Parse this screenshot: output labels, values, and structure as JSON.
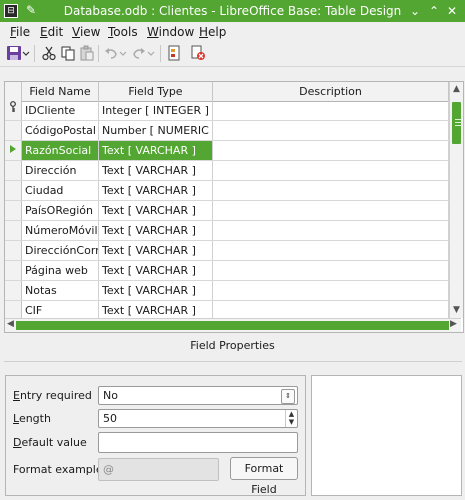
{
  "window": {
    "title": "Database.odb : Clientes - LibreOffice Base: Table Design",
    "app_icon_glyph": "⊟",
    "pin_glyph": "✎",
    "minimize_glyph": "⌄",
    "maximize_glyph": "⌃",
    "close_glyph": "✕"
  },
  "menu": [
    {
      "label": "File",
      "accel": "F",
      "rest": "ile"
    },
    {
      "label": "Edit",
      "accel": "E",
      "rest": "dit"
    },
    {
      "label": "View",
      "accel": "V",
      "rest": "iew"
    },
    {
      "label": "Tools",
      "accel": "T",
      "rest": "ools"
    },
    {
      "label": "Window",
      "accel": "W",
      "rest": "indow"
    },
    {
      "label": "Help",
      "accel": "H",
      "rest": "elp"
    }
  ],
  "toolbar": {
    "icons": [
      "save-icon",
      "cut-icon",
      "copy-icon",
      "paste-icon",
      "undo-icon",
      "redo-icon",
      "index-design-icon",
      "primary-key-icon"
    ]
  },
  "grid": {
    "columns": [
      "Field Name",
      "Field Type",
      "Description"
    ],
    "rows": [
      {
        "marker": "key",
        "name": "IDCliente",
        "type": "Integer [ INTEGER ]",
        "description": ""
      },
      {
        "marker": "",
        "name": "CódigoPostal",
        "type": "Number [ NUMERIC ]",
        "description": ""
      },
      {
        "marker": "current",
        "name": "RazónSocial",
        "type": "Text [ VARCHAR ]",
        "description": "",
        "selected": true
      },
      {
        "marker": "",
        "name": "Dirección",
        "type": "Text [ VARCHAR ]",
        "description": ""
      },
      {
        "marker": "",
        "name": "Ciudad",
        "type": "Text [ VARCHAR ]",
        "description": ""
      },
      {
        "marker": "",
        "name": "PaísORegión",
        "type": "Text [ VARCHAR ]",
        "description": ""
      },
      {
        "marker": "",
        "name": "NúmeroMóvil",
        "type": "Text [ VARCHAR ]",
        "description": ""
      },
      {
        "marker": "",
        "name": "DirecciónCorreo",
        "type": "Text [ VARCHAR ]",
        "description": ""
      },
      {
        "marker": "",
        "name": "Página web",
        "type": "Text [ VARCHAR ]",
        "description": ""
      },
      {
        "marker": "",
        "name": "Notas",
        "type": "Text [ VARCHAR ]",
        "description": ""
      },
      {
        "marker": "",
        "name": "CIF",
        "type": "Text [ VARCHAR ]",
        "description": ""
      }
    ]
  },
  "field_properties": {
    "heading": "Field Properties",
    "entry_required": {
      "accel": "E",
      "rest": "ntry required",
      "value": "No"
    },
    "length": {
      "accel": "L",
      "rest": "ength",
      "value": "50"
    },
    "default_value": {
      "accel": "D",
      "rest": "efault value",
      "value": ""
    },
    "format_example": {
      "label": "Format example",
      "value": "@"
    },
    "format_button": {
      "label": "Format Field"
    }
  },
  "colors": {
    "accent": "#53a632",
    "selected_text": "#ffffff"
  }
}
